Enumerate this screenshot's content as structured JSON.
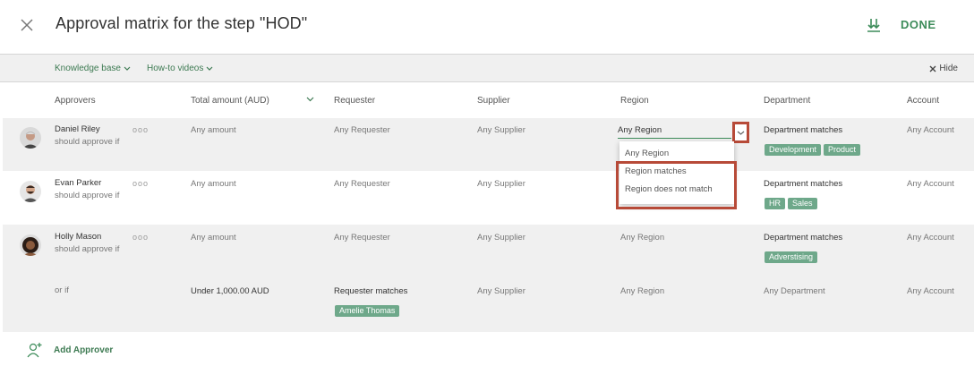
{
  "header": {
    "title": "Approval matrix for the step \"HOD\"",
    "done_label": "DONE"
  },
  "subbar": {
    "knowledge_base": "Knowledge base",
    "howto_videos": "How-to videos",
    "hide": "Hide"
  },
  "columns": {
    "approvers": "Approvers",
    "total_amount": "Total amount (AUD)",
    "requester": "Requester",
    "supplier": "Supplier",
    "region": "Region",
    "department": "Department",
    "account": "Account"
  },
  "rows": [
    {
      "name": "Daniel Riley",
      "condition": "should approve if",
      "dots": "ooo",
      "amount": "Any amount",
      "requester": "Any Requester",
      "supplier": "Any Supplier",
      "region": "Any Region",
      "department": "Department matches",
      "dept_tags": [
        "Development",
        "Product"
      ],
      "account": "Any Account"
    },
    {
      "name": "Evan Parker",
      "condition": "should approve if",
      "dots": "ooo",
      "amount": "Any amount",
      "requester": "Any Requester",
      "supplier": "Any Supplier",
      "region": "",
      "department": "Department matches",
      "dept_tags": [
        "HR",
        "Sales"
      ],
      "account": "Any Account"
    },
    {
      "name": "Holly Mason",
      "condition": "should approve if",
      "dots": "ooo",
      "amount": "Any amount",
      "requester": "Any Requester",
      "supplier": "Any Supplier",
      "region": "Any Region",
      "department": "Department matches",
      "dept_tags": [
        "Adverstising"
      ],
      "account": "Any Account"
    },
    {
      "name": "",
      "condition": "or if",
      "amount": "Under 1,000.00 AUD",
      "requester": "Requester matches",
      "requester_tag": "Amelie Thomas",
      "supplier": "Any Supplier",
      "region": "Any Region",
      "department": "Any Department",
      "account": "Any Account"
    }
  ],
  "region_dropdown": {
    "selected": "Any Region",
    "options": [
      "Any Region",
      "Region matches",
      "Region does not match"
    ]
  },
  "add_approver": "Add Approver",
  "colors": {
    "accent": "#3d8c5a",
    "tag": "#6ea88a",
    "highlight": "#b74a38",
    "row_bg": "#f0f0f0"
  }
}
